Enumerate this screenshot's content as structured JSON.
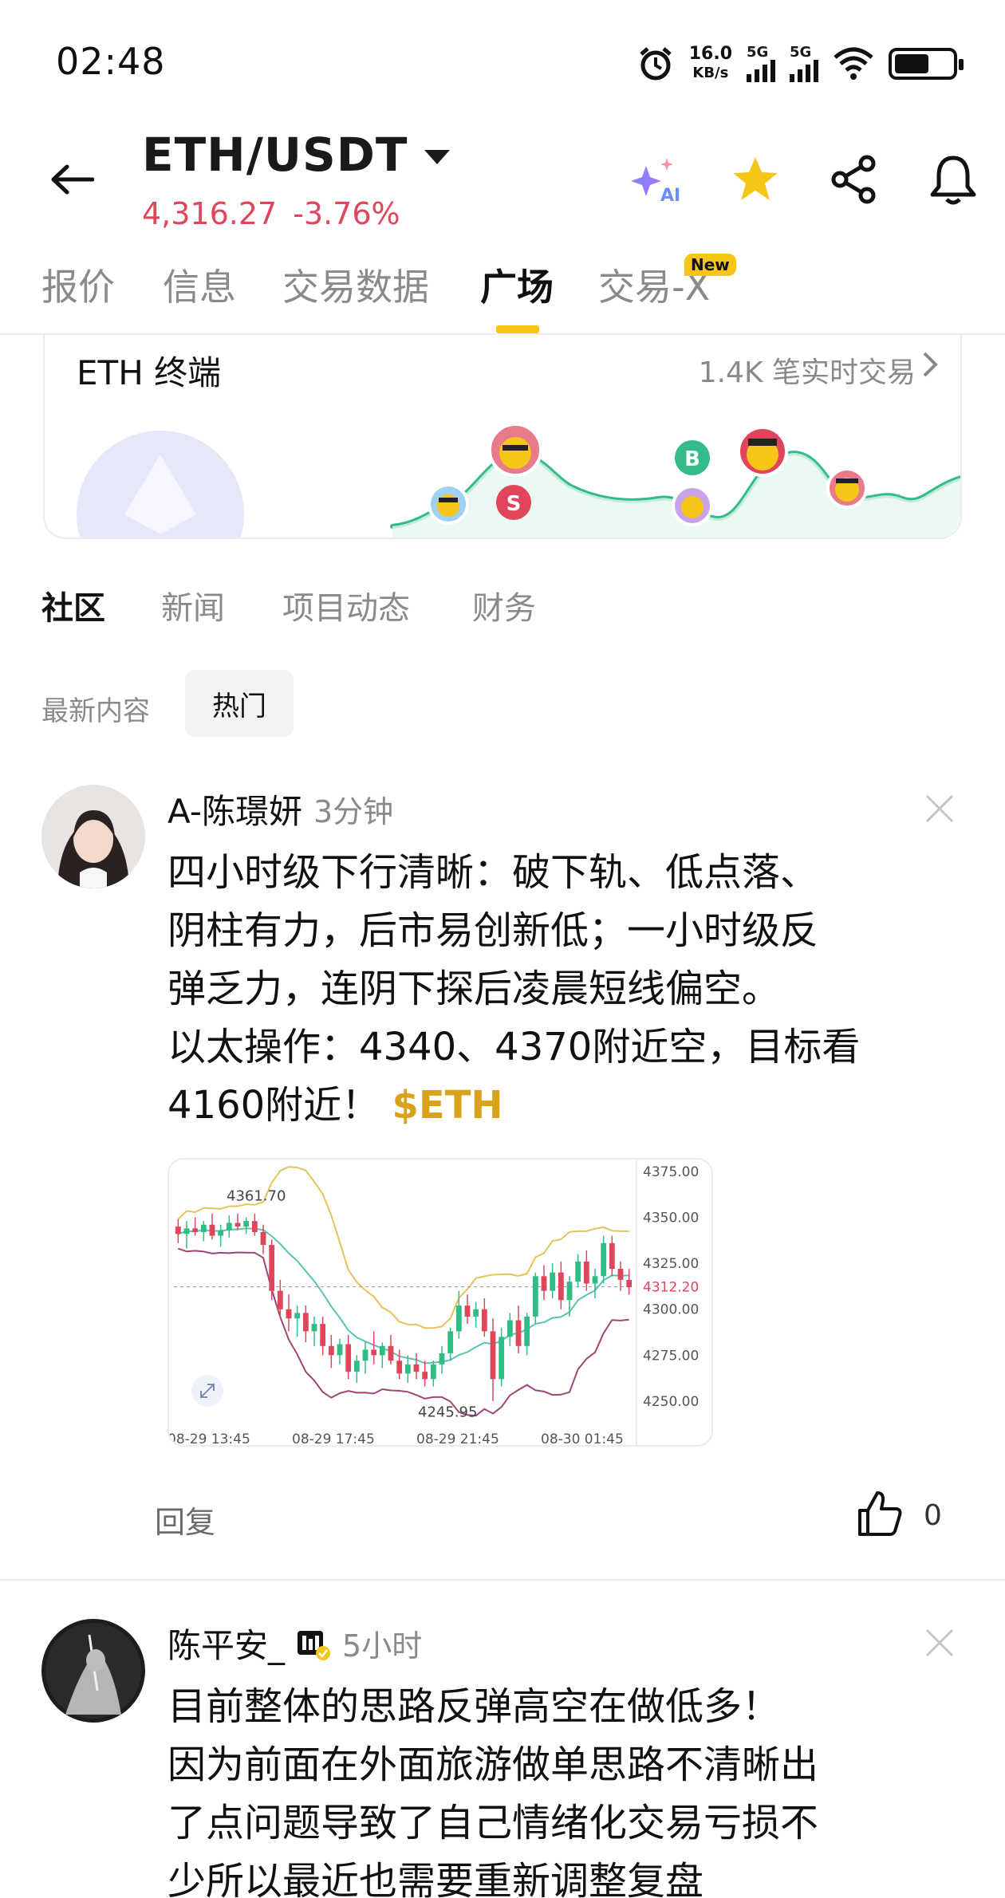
{
  "status_bar": {
    "time": "02:48",
    "speed_value": "16.0",
    "speed_unit": "KB/s",
    "signal1": "5G",
    "signal2": "5G"
  },
  "header": {
    "pair": "ETH/USDT",
    "price": "4,316.27",
    "change": "-3.76%",
    "ai_label": "AI"
  },
  "tabs": [
    {
      "label": "报价"
    },
    {
      "label": "信息"
    },
    {
      "label": "交易数据"
    },
    {
      "label": "广场"
    },
    {
      "label": "交易-X"
    }
  ],
  "tab_new_badge": "New",
  "terminal": {
    "title": "ETH 终端",
    "trades": "1.4K 笔实时交易",
    "markers": [
      "S",
      "B"
    ]
  },
  "sub_tabs": [
    {
      "label": "社区"
    },
    {
      "label": "新闻"
    },
    {
      "label": "项目动态"
    },
    {
      "label": "财务"
    }
  ],
  "filters": {
    "latest": "最新内容",
    "hot": "热门"
  },
  "post1": {
    "author": "A-陈璟妍",
    "ago": "3分钟",
    "lines": [
      "四小时级下行清晰：破下轨、低点落、",
      "阴柱有力，后市易创新低；一小时级反",
      "弹乏力，连阴下探后凌晨短线偏空。",
      "以太操作：4340、4370附近空，目标看",
      "4160附近！"
    ],
    "ticker": "$ETH",
    "reply": "回复",
    "likes": "0"
  },
  "post2": {
    "author": "陈平安_",
    "ago": "5小时",
    "lines": [
      "目前整体的思路反弹高空在做低多！",
      "因为前面在外面旅游做单思路不清晰出",
      "了点问题导致了自己情绪化交易亏损不",
      "少所以最近也需要重新调整复盘"
    ]
  },
  "chart_data": {
    "type": "candlestick",
    "y_ticks": [
      "4375.00",
      "4350.00",
      "4325.00",
      "4312.20",
      "4300.00",
      "4275.00",
      "4250.00"
    ],
    "x_ticks": [
      "08-29 13:45",
      "08-29 17:45",
      "08-29 21:45",
      "08-30 01:45"
    ],
    "annotations": [
      "4361.70",
      "4245.95"
    ],
    "ylim": [
      4240,
      4378
    ],
    "current_price": 4312.2,
    "colors": {
      "up": "#2ebd85",
      "down": "#e0455c",
      "upper_band": "#e6c35a",
      "mid_band": "#59c3b5",
      "lower_band": "#a0457a"
    },
    "candles": [
      [
        4345,
        4349,
        4336,
        4341
      ],
      [
        4341,
        4348,
        4333,
        4344
      ],
      [
        4344,
        4350,
        4340,
        4342
      ],
      [
        4342,
        4348,
        4337,
        4346
      ],
      [
        4346,
        4352,
        4338,
        4340
      ],
      [
        4340,
        4346,
        4334,
        4343
      ],
      [
        4343,
        4351,
        4339,
        4347
      ],
      [
        4347,
        4352,
        4343,
        4345
      ],
      [
        4345,
        4350,
        4341,
        4348
      ],
      [
        4348,
        4352,
        4340,
        4342
      ],
      [
        4342,
        4346,
        4330,
        4335
      ],
      [
        4335,
        4338,
        4305,
        4310
      ],
      [
        4310,
        4316,
        4295,
        4300
      ],
      [
        4300,
        4308,
        4288,
        4295
      ],
      [
        4295,
        4302,
        4285,
        4298
      ],
      [
        4298,
        4302,
        4282,
        4288
      ],
      [
        4288,
        4296,
        4280,
        4292
      ],
      [
        4292,
        4296,
        4275,
        4280
      ],
      [
        4280,
        4286,
        4268,
        4275
      ],
      [
        4275,
        4284,
        4270,
        4281
      ],
      [
        4281,
        4286,
        4262,
        4266
      ],
      [
        4266,
        4275,
        4260,
        4272
      ],
      [
        4272,
        4282,
        4265,
        4278
      ],
      [
        4278,
        4288,
        4270,
        4275
      ],
      [
        4275,
        4282,
        4268,
        4280
      ],
      [
        4280,
        4286,
        4270,
        4272
      ],
      [
        4272,
        4278,
        4262,
        4265
      ],
      [
        4265,
        4275,
        4260,
        4270
      ],
      [
        4270,
        4276,
        4262,
        4266
      ],
      [
        4266,
        4272,
        4258,
        4262
      ],
      [
        4262,
        4272,
        4258,
        4270
      ],
      [
        4270,
        4280,
        4265,
        4276
      ],
      [
        4276,
        4290,
        4272,
        4288
      ],
      [
        4288,
        4310,
        4284,
        4302
      ],
      [
        4302,
        4308,
        4292,
        4296
      ],
      [
        4296,
        4304,
        4290,
        4300
      ],
      [
        4300,
        4306,
        4285,
        4288
      ],
      [
        4288,
        4295,
        4250,
        4262
      ],
      [
        4262,
        4290,
        4258,
        4285
      ],
      [
        4285,
        4298,
        4280,
        4294
      ],
      [
        4294,
        4302,
        4276,
        4280
      ],
      [
        4280,
        4298,
        4275,
        4296
      ],
      [
        4296,
        4320,
        4292,
        4318
      ],
      [
        4318,
        4324,
        4305,
        4310
      ],
      [
        4310,
        4325,
        4306,
        4320
      ],
      [
        4320,
        4326,
        4300,
        4305
      ],
      [
        4305,
        4318,
        4296,
        4315
      ],
      [
        4315,
        4330,
        4312,
        4326
      ],
      [
        4326,
        4332,
        4310,
        4314
      ],
      [
        4314,
        4322,
        4306,
        4318
      ],
      [
        4318,
        4340,
        4314,
        4336
      ],
      [
        4336,
        4340,
        4318,
        4322
      ],
      [
        4322,
        4326,
        4310,
        4316
      ],
      [
        4316,
        4322,
        4308,
        4312
      ]
    ]
  }
}
